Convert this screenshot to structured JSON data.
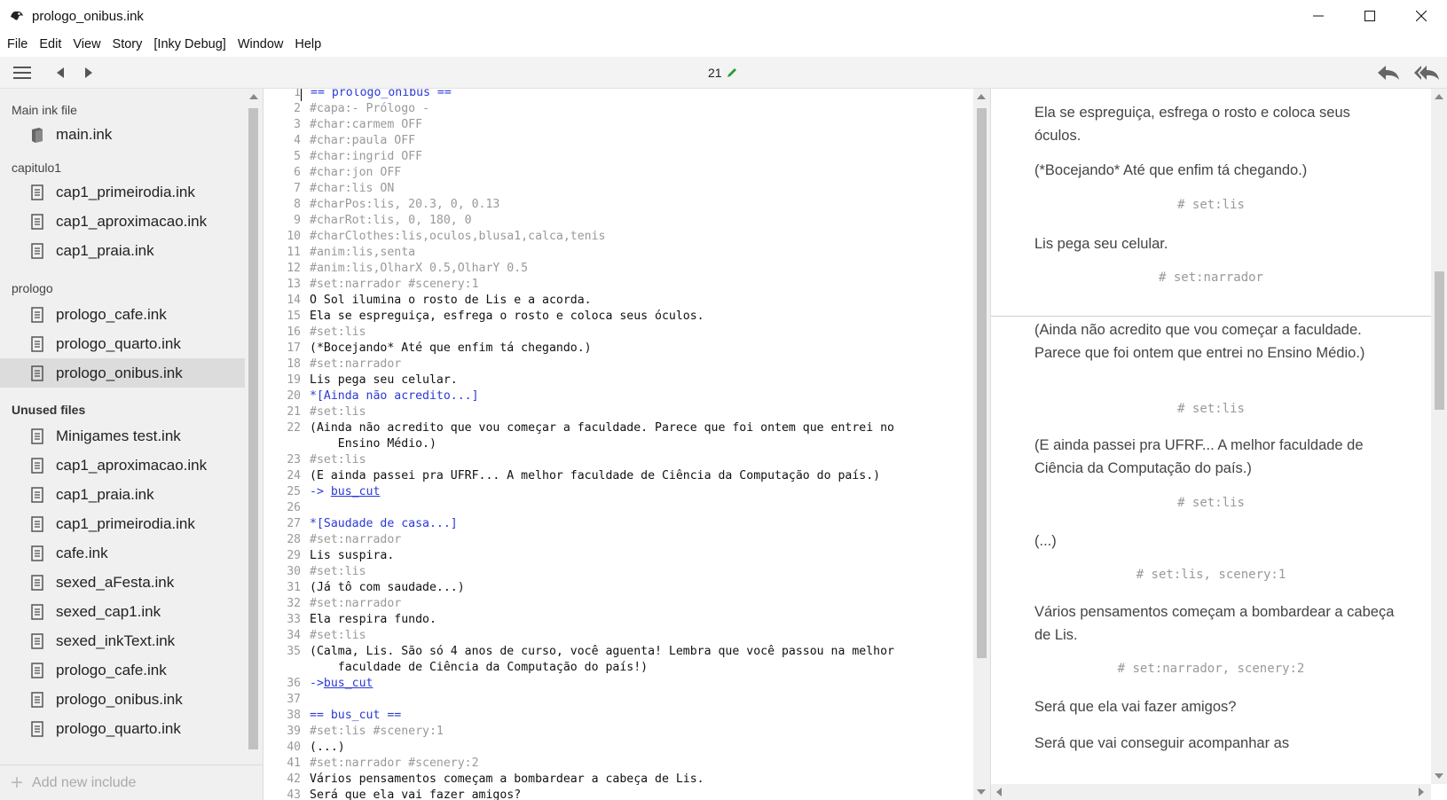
{
  "window": {
    "title": "prologo_onibus.ink"
  },
  "menu": [
    "File",
    "Edit",
    "View",
    "Story",
    "[Inky Debug]",
    "Window",
    "Help"
  ],
  "toolbar": {
    "word_count": "21"
  },
  "sidebar": {
    "main_label": "Main ink file",
    "main_file": "main.ink",
    "group1": "capitulo1",
    "group1_files": [
      "cap1_primeirodia.ink",
      "cap1_aproximacao.ink",
      "cap1_praia.ink"
    ],
    "group2": "prologo",
    "group2_files": [
      "prologo_cafe.ink",
      "prologo_quarto.ink",
      "prologo_onibus.ink"
    ],
    "unused_label": "Unused files",
    "unused_files": [
      "Minigames test.ink",
      "cap1_aproximacao.ink",
      "cap1_praia.ink",
      "cap1_primeirodia.ink",
      "cafe.ink",
      "sexed_aFesta.ink",
      "sexed_cap1.ink",
      "sexed_inkText.ink",
      "prologo_cafe.ink",
      "prologo_onibus.ink",
      "prologo_quarto.ink"
    ],
    "add_include": "Add new include"
  },
  "editor": {
    "lines": [
      {
        "n": "1",
        "t": "== prologo_onibus ==",
        "k": "knot"
      },
      {
        "n": "2",
        "t": "#capa:- Prólogo -",
        "k": "tag"
      },
      {
        "n": "3",
        "t": "#char:carmem OFF",
        "k": "tag"
      },
      {
        "n": "4",
        "t": "#char:paula OFF",
        "k": "tag"
      },
      {
        "n": "5",
        "t": "#char:ingrid OFF",
        "k": "tag"
      },
      {
        "n": "6",
        "t": "#char:jon OFF",
        "k": "tag"
      },
      {
        "n": "7",
        "t": "#char:lis ON",
        "k": "tag"
      },
      {
        "n": "8",
        "t": "#charPos:lis, 20.3, 0, 0.13",
        "k": "tag"
      },
      {
        "n": "9",
        "t": "#charRot:lis, 0, 180, 0",
        "k": "tag"
      },
      {
        "n": "10",
        "t": "#charClothes:lis,oculos,blusa1,calca,tenis",
        "k": "tag"
      },
      {
        "n": "11",
        "t": "#anim:lis,senta",
        "k": "tag"
      },
      {
        "n": "12",
        "t": "#anim:lis,OlharX 0.5,OlharY 0.5",
        "k": "tag"
      },
      {
        "n": "13",
        "t": "#set:narrador #scenery:1",
        "k": "tag"
      },
      {
        "n": "14",
        "t": "O Sol ilumina o rosto de Lis e a acorda.",
        "k": "text"
      },
      {
        "n": "15",
        "t": "Ela se espreguiça, esfrega o rosto e coloca seus óculos.",
        "k": "text"
      },
      {
        "n": "16",
        "t": "#set:lis",
        "k": "tag"
      },
      {
        "n": "17",
        "t": "(*Bocejando* Até que enfim tá chegando.)",
        "k": "text"
      },
      {
        "n": "18",
        "t": "#set:narrador",
        "k": "tag"
      },
      {
        "n": "19",
        "t": "Lis pega seu celular.",
        "k": "text"
      },
      {
        "n": "20",
        "t": "*[Ainda não acredito...]",
        "k": "choice"
      },
      {
        "n": "21",
        "t": "#set:lis",
        "k": "tag"
      },
      {
        "n": "22",
        "t": "(Ainda não acredito que vou começar a faculdade. Parece que foi ontem que entrei no\n    Ensino Médio.)",
        "k": "text"
      },
      {
        "n": "23",
        "t": "#set:lis",
        "k": "tag"
      },
      {
        "n": "24",
        "t": "(E ainda passei pra UFRF... A melhor faculdade de Ciência da Computação do país.)",
        "k": "text"
      },
      {
        "n": "25",
        "t": "-> ",
        "k": "divert",
        "link": "bus_cut"
      },
      {
        "n": "26",
        "t": "",
        "k": "text"
      },
      {
        "n": "27",
        "t": "*[Saudade de casa...]",
        "k": "choice"
      },
      {
        "n": "28",
        "t": "#set:narrador",
        "k": "tag"
      },
      {
        "n": "29",
        "t": "Lis suspira.",
        "k": "text"
      },
      {
        "n": "30",
        "t": "#set:lis",
        "k": "tag"
      },
      {
        "n": "31",
        "t": "(Já tô com saudade...)",
        "k": "text"
      },
      {
        "n": "32",
        "t": "#set:narrador",
        "k": "tag"
      },
      {
        "n": "33",
        "t": "Ela respira fundo.",
        "k": "text"
      },
      {
        "n": "34",
        "t": "#set:lis",
        "k": "tag"
      },
      {
        "n": "35",
        "t": "(Calma, Lis. São só 4 anos de curso, você aguenta! Lembra que você passou na melhor\n    faculdade de Ciência da Computação do país!)",
        "k": "text"
      },
      {
        "n": "36",
        "t": "->",
        "k": "divert",
        "link": "bus_cut"
      },
      {
        "n": "37",
        "t": "",
        "k": "text"
      },
      {
        "n": "38",
        "t": "== bus_cut ==",
        "k": "knot"
      },
      {
        "n": "39",
        "t": "#set:lis #scenery:1",
        "k": "tag"
      },
      {
        "n": "40",
        "t": "(...)",
        "k": "text"
      },
      {
        "n": "41",
        "t": "#set:narrador #scenery:2",
        "k": "tag"
      },
      {
        "n": "42",
        "t": "Vários pensamentos começam a bombardear a cabeça de Lis.",
        "k": "text"
      },
      {
        "n": "43",
        "t": "Será que ela vai fazer amigos?",
        "k": "text"
      }
    ]
  },
  "player": {
    "items": [
      {
        "kind": "text",
        "t": "Ela se espreguiça, esfrega o rosto e coloca seus óculos."
      },
      {
        "kind": "text",
        "t": "(*Bocejando* Até que enfim tá chegando.)"
      },
      {
        "kind": "tag",
        "t": "# set:lis"
      },
      {
        "kind": "text",
        "t": "Lis pega seu celular."
      },
      {
        "kind": "tag",
        "t": "# set:narrador"
      },
      {
        "kind": "text",
        "t": "(Ainda não acredito que vou começar a faculdade. Parece que foi ontem que entrei no Ensino Médio.)"
      },
      {
        "kind": "tag",
        "t": "# set:lis"
      },
      {
        "kind": "text",
        "t": "(E ainda passei pra UFRF... A melhor faculdade de Ciência da Computação do país.)"
      },
      {
        "kind": "tag",
        "t": "# set:lis"
      },
      {
        "kind": "text",
        "t": "(...)"
      },
      {
        "kind": "tag",
        "t": "# set:lis, scenery:1"
      },
      {
        "kind": "text",
        "t": "Vários pensamentos começam a bombardear a cabeça de Lis."
      },
      {
        "kind": "tag",
        "t": "# set:narrador, scenery:2"
      },
      {
        "kind": "text",
        "t": "Será que ela vai fazer amigos?"
      },
      {
        "kind": "text",
        "t": "Será que vai conseguir acompanhar as"
      }
    ]
  },
  "colors": {
    "accent_link": "#2a39d6",
    "tag_gray": "#999999",
    "word_count_pencil": "#2a9d3a"
  }
}
